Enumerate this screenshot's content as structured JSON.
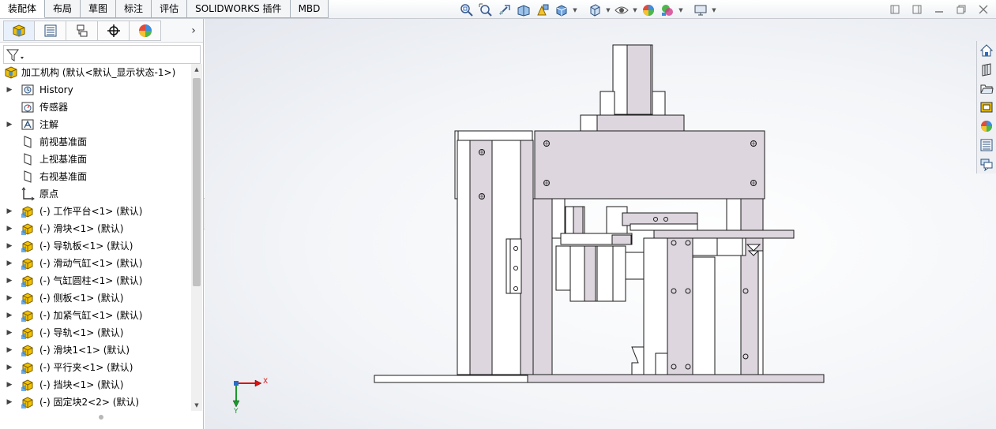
{
  "command_tabs": [
    {
      "label": "装配体",
      "active": true
    },
    {
      "label": "布局",
      "active": false
    },
    {
      "label": "草图",
      "active": false
    },
    {
      "label": "标注",
      "active": false
    },
    {
      "label": "评估",
      "active": false
    },
    {
      "label": "SOLIDWORKS 插件",
      "active": false
    },
    {
      "label": "MBD",
      "active": false
    }
  ],
  "heads_up_toolbar": [
    "zoom-to-fit-icon",
    "zoom-to-area-icon",
    "previous-view-icon",
    "section-view-icon",
    "dynamic-annotation-icon",
    "view-orientation-icon",
    "display-style-icon",
    "hide-show-items-icon",
    "edit-appearance-icon",
    "apply-scene-icon",
    "view-settings-icon"
  ],
  "manager_tabs": [
    "featuremanager-tab",
    "propertymanager-tab",
    "configurationmanager-tab",
    "dimxpertmanager-tab",
    "displaymanager-tab"
  ],
  "tree": {
    "root": "加工机构  (默认<默认_显示状态-1>)",
    "items": [
      {
        "label": "History",
        "icon": "history-folder-icon",
        "expandable": true
      },
      {
        "label": "传感器",
        "icon": "sensor-icon",
        "expandable": false
      },
      {
        "label": "注解",
        "icon": "annotation-icon",
        "expandable": true
      },
      {
        "label": "前视基准面",
        "icon": "plane-icon",
        "expandable": false
      },
      {
        "label": "上视基准面",
        "icon": "plane-icon",
        "expandable": false
      },
      {
        "label": "右视基准面",
        "icon": "plane-icon",
        "expandable": false
      },
      {
        "label": "原点",
        "icon": "origin-icon",
        "expandable": false
      },
      {
        "label": "(-) 工作平台<1> (默认)",
        "icon": "part-icon",
        "expandable": true
      },
      {
        "label": "(-) 滑块<1> (默认)",
        "icon": "part-icon",
        "expandable": true
      },
      {
        "label": "(-) 导轨板<1> (默认)",
        "icon": "part-icon",
        "expandable": true
      },
      {
        "label": "(-) 滑动气缸<1> (默认)",
        "icon": "part-icon",
        "expandable": true
      },
      {
        "label": "(-) 气缸圆柱<1> (默认)",
        "icon": "part-icon",
        "expandable": true
      },
      {
        "label": "(-) 侧板<1> (默认)",
        "icon": "part-icon",
        "expandable": true
      },
      {
        "label": "(-) 加紧气缸<1> (默认)",
        "icon": "part-icon",
        "expandable": true
      },
      {
        "label": "(-) 导轨<1> (默认)",
        "icon": "part-icon",
        "expandable": true
      },
      {
        "label": "(-) 滑块1<1> (默认)",
        "icon": "part-icon",
        "expandable": true
      },
      {
        "label": "(-) 平行夹<1> (默认)",
        "icon": "part-icon",
        "expandable": true
      },
      {
        "label": "(-) 挡块<1> (默认)",
        "icon": "part-icon",
        "expandable": true
      },
      {
        "label": "(-) 固定块2<2> (默认)",
        "icon": "part-icon",
        "expandable": true
      }
    ]
  },
  "triad": {
    "x_label": "X",
    "y_label": "Y"
  },
  "task_pane": [
    "solidworks-resources-icon",
    "design-library-icon",
    "file-explorer-icon",
    "view-palette-icon",
    "appearances-icon",
    "custom-properties-icon",
    "forum-icon"
  ],
  "colors": {
    "part_fill": "#ddd6de",
    "edge": "#1a1a1a",
    "part_icon": "#f2c200",
    "triad_x": "#d11",
    "triad_y": "#1a9a2a",
    "accent": "#2b6cc4"
  }
}
